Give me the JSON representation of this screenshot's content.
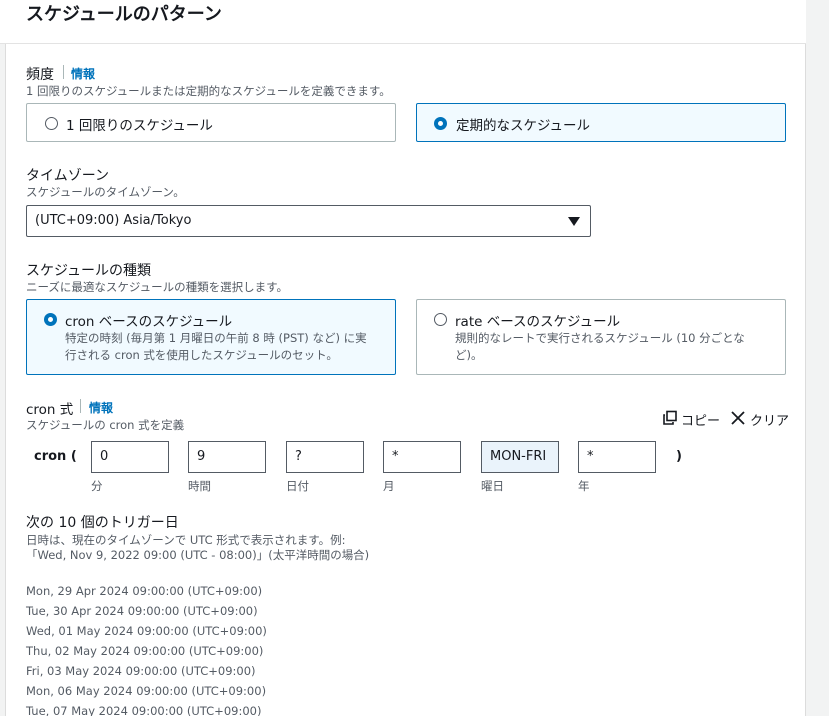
{
  "section_title": "スケジュールのパターン",
  "frequency": {
    "label": "頻度",
    "info": "情報",
    "description": "1 回限りのスケジュールまたは定期的なスケジュールを定義できます。",
    "options": [
      "1 回限りのスケジュール",
      "定期的なスケジュール"
    ],
    "selected": "定期的なスケジュール"
  },
  "timezone": {
    "label": "タイムゾーン",
    "description": "スケジュールのタイムゾーン。",
    "value": "(UTC+09:00) Asia/Tokyo"
  },
  "schedule_type": {
    "label": "スケジュールの種類",
    "description": "ニーズに最適なスケジュールの種類を選択します。",
    "cron": {
      "title": "cron ベースのスケジュール",
      "description": "特定の時刻 (毎月第 1 月曜日の午前 8 時 (PST) など) に実行される cron 式を使用したスケジュールのセット。"
    },
    "rate": {
      "title": "rate ベースのスケジュール",
      "description": "規則的なレートで実行されるスケジュール (10 分ごとなど)。"
    },
    "selected": "cron"
  },
  "cron": {
    "label": "cron 式",
    "info": "情報",
    "description": "スケジュールの cron 式を定義",
    "copy": "コピー",
    "clear": "クリア",
    "prefix": "cron (",
    "suffix": ")",
    "fields": [
      {
        "value": "0",
        "label": "分"
      },
      {
        "value": "9",
        "label": "時間"
      },
      {
        "value": "?",
        "label": "日付"
      },
      {
        "value": "*",
        "label": "月"
      },
      {
        "value": "MON-FRI",
        "label": "曜日"
      },
      {
        "value": "*",
        "label": "年"
      }
    ]
  },
  "triggers": {
    "title": "次の 10 個のトリガー日",
    "description_line1": "日時は、現在のタイムゾーンで UTC 形式で表示されます。例:",
    "description_line2": "「Wed, Nov 9, 2022 09:00 (UTC - 08:00)」(太平洋時間の場合)",
    "dates": [
      "Mon, 29 Apr 2024 09:00:00 (UTC+09:00)",
      "Tue, 30 Apr 2024 09:00:00 (UTC+09:00)",
      "Wed, 01 May 2024 09:00:00 (UTC+09:00)",
      "Thu, 02 May 2024 09:00:00 (UTC+09:00)",
      "Fri, 03 May 2024 09:00:00 (UTC+09:00)",
      "Mon, 06 May 2024 09:00:00 (UTC+09:00)",
      "Tue, 07 May 2024 09:00:00 (UTC+09:00)"
    ]
  }
}
